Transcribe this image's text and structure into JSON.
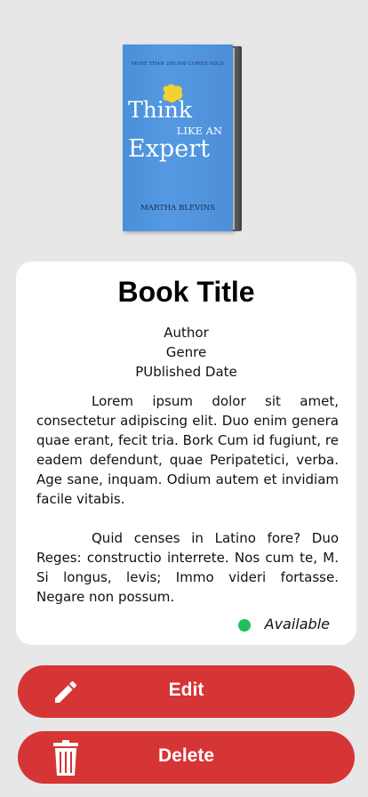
{
  "cover": {
    "top_line": "MORE THAN 200,000 COPIES SOLD",
    "title_line1": "Think",
    "title_line2": "LIKE AN",
    "title_line3": "Expert",
    "author": "MARTHA BLEVINS",
    "color": "#4a90d9"
  },
  "book": {
    "title": "Book Title",
    "author": "Author",
    "genre": "Genre",
    "published_date": "PUblished Date",
    "description": [
      "Lorem ipsum dolor sit amet, consectetur adipiscing elit. Duo enim genera quae erant, fecit tria. Bork Cum id fugiunt, re eadem defendunt, quae Peripatetici, verba. Age sane, inquam. Odium autem et invidiam facile vitabis.",
      "Quid censes in Latino fore? Duo Reges: constructio interrete. Nos cum te, M. Si longus, levis; Immo videri fortasse. Negare non possum."
    ],
    "status": "Available",
    "status_color": "#1fc05c"
  },
  "actions": {
    "edit_label": "Edit",
    "edit_icon": "pencil-icon",
    "delete_label": "Delete",
    "delete_icon": "trash-icon",
    "button_color": "#d63535"
  }
}
